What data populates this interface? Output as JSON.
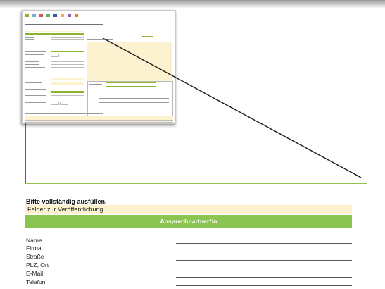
{
  "form": {
    "notice": "Bitte vollständig ausfüllen.",
    "publication_bar": "Felder zur Veröffentlichung",
    "section_title": "Ansprechpartner*in",
    "fields": [
      {
        "label": "Name"
      },
      {
        "label": "Firma"
      },
      {
        "label": "Straße"
      },
      {
        "label": "PLZ, Ort"
      },
      {
        "label": "E-Mail"
      },
      {
        "label": "Telefon"
      }
    ]
  },
  "colors": {
    "accent_green": "#8cc452",
    "highlight_beige": "#fdf2cf"
  }
}
